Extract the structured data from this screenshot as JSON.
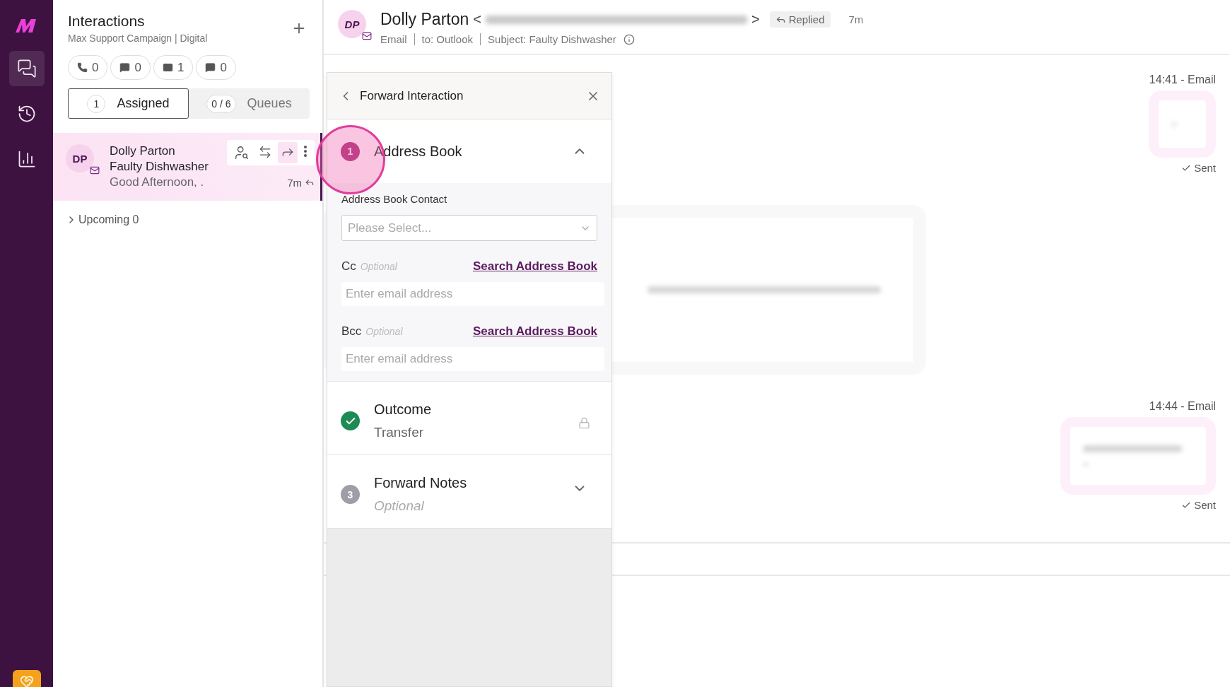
{
  "nav": {
    "items": [
      {
        "kind": "conversations",
        "selected": true
      },
      {
        "kind": "history",
        "selected": false
      },
      {
        "kind": "reports",
        "selected": false
      }
    ]
  },
  "interactions": {
    "title": "Interactions",
    "subtitle": "Max Support Campaign | Digital",
    "counters": [
      {
        "kind": "phone",
        "count": "0"
      },
      {
        "kind": "chat",
        "count": "0"
      },
      {
        "kind": "email",
        "count": "1"
      },
      {
        "kind": "sms",
        "count": "0"
      }
    ],
    "tabs": [
      {
        "badge": "1",
        "label": "Assigned",
        "selected": true
      },
      {
        "badge": "0 / 6",
        "label": "Queues",
        "selected": false
      }
    ],
    "items": [
      {
        "initials": "DP",
        "name": "Dolly Parton",
        "subject": "Faulty Dishwasher",
        "preview": "Good Afternoon, .",
        "time": "7m",
        "selected": true
      }
    ],
    "upcoming": {
      "label": "Upcoming 0",
      "expanded": false
    }
  },
  "header": {
    "initials": "DP",
    "name": "Dolly Parton",
    "open_bracket": "<",
    "close_bracket": ">",
    "status": "Replied",
    "time": "7m",
    "meta": [
      "Email",
      "to: Outlook",
      "Subject: Faulty Dishwasher"
    ]
  },
  "forward": {
    "title": "Forward Interaction",
    "steps": [
      {
        "kind": "active",
        "number": "1",
        "title": "Address Book",
        "expanded": true
      },
      {
        "kind": "done",
        "title": "Outcome",
        "subtitle": "Transfer",
        "locked": true
      },
      {
        "kind": "pending",
        "number": "3",
        "title": "Forward Notes",
        "subtitle": "Optional",
        "expanded": false
      }
    ],
    "contact": {
      "label": "Address Book Contact",
      "placeholder": "Please Select..."
    },
    "copies": [
      {
        "label": "Cc",
        "hint": "Optional",
        "link": "Search Address Book",
        "placeholder": "Enter email address"
      },
      {
        "label": "Bcc",
        "hint": "Optional",
        "link": "Search Address Book",
        "placeholder": "Enter email address"
      }
    ]
  },
  "messages": [
    {
      "kind": "ping",
      "time": "14:41 - Email",
      "status": "Sent"
    },
    {
      "kind": "inbound"
    },
    {
      "kind": "outbound",
      "time": "14:44 - Email",
      "status": "Sent"
    }
  ]
}
